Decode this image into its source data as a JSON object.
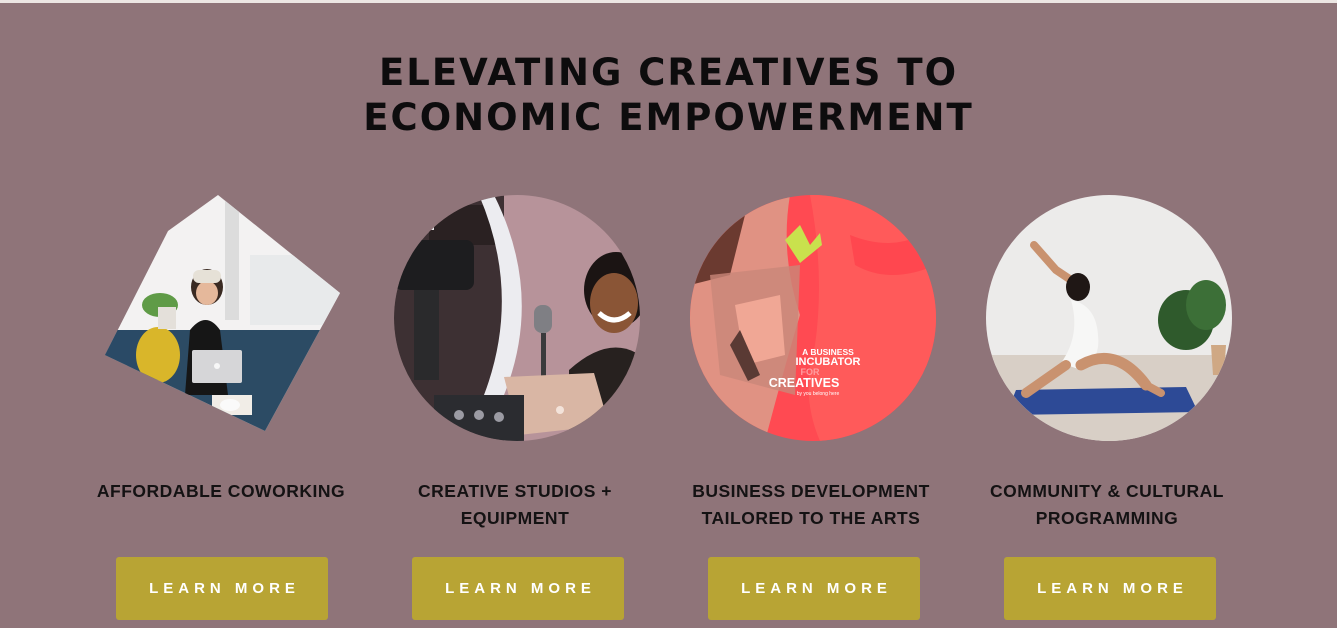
{
  "headline": {
    "line1": "ELEVATING CREATIVES TO",
    "line2": "ECONOMIC EMPOWERMENT"
  },
  "cards": [
    {
      "title_line1": "AFFORDABLE COWORKING",
      "title_line2": "",
      "button_label": "LEARN MORE",
      "image": "woman-with-laptop-photo"
    },
    {
      "title_line1": "CREATIVE STUDIOS +",
      "title_line2": "EQUIPMENT",
      "button_label": "LEARN MORE",
      "image": "podcast-studio-photo"
    },
    {
      "title_line1": "BUSINESS DEVELOPMENT",
      "title_line2": "TAILORED TO THE ARTS",
      "button_label": "LEARN MORE",
      "image": "incubator-graphic",
      "graphic_text": {
        "l1": "A BUSINESS",
        "l2": "INCUBATOR",
        "l3": "FOR",
        "l4": "CREATIVES",
        "l5": "by you belong here"
      }
    },
    {
      "title_line1": "COMMUNITY & CULTURAL",
      "title_line2": "PROGRAMMING",
      "button_label": "LEARN MORE",
      "image": "yoga-pose-photo"
    }
  ],
  "colors": {
    "background": "#8f7479",
    "button": "#b8a434",
    "button_text": "#ffffff",
    "heading_text": "#0d0c0d"
  }
}
